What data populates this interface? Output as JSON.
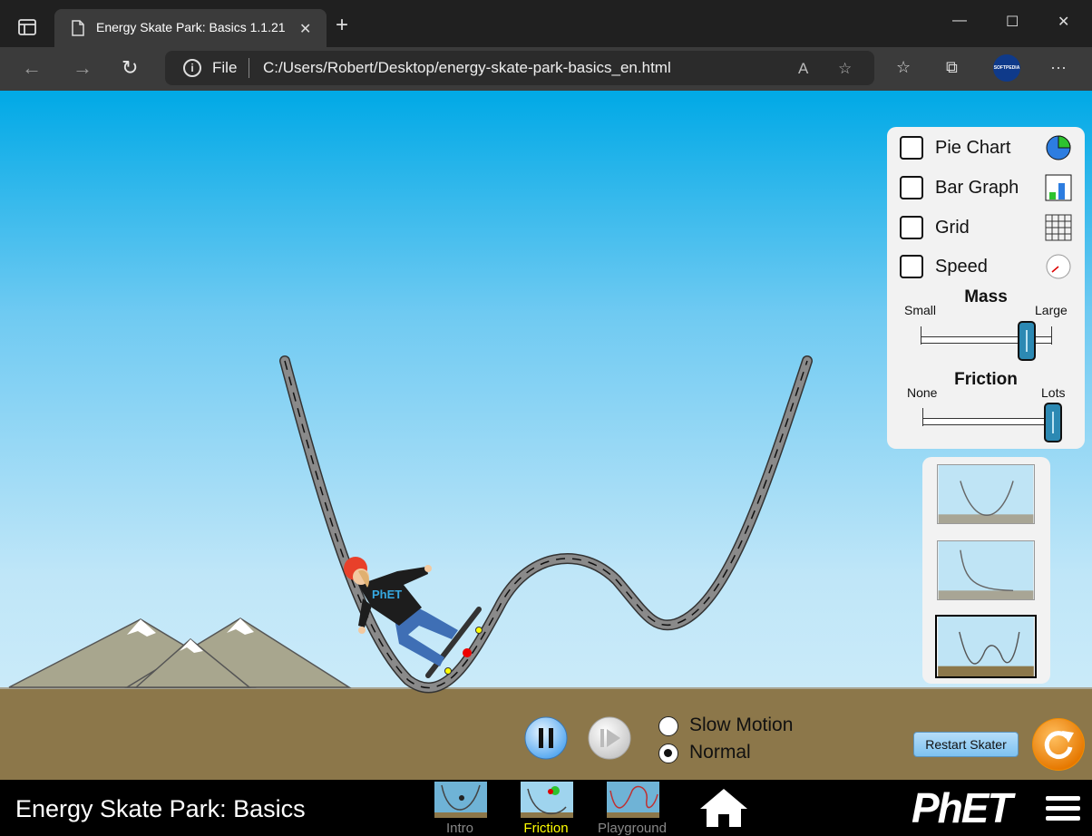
{
  "browser": {
    "tab_title": "Energy Skate Park: Basics 1.1.21",
    "address_scheme": "File",
    "address_url": "C:/Users/Robert/Desktop/energy-skate-park-basics_en.html",
    "profile_label": "SOFTPEDIA"
  },
  "control_panel": {
    "checkboxes": [
      {
        "label": "Pie Chart",
        "checked": false,
        "icon": "pie-chart-icon"
      },
      {
        "label": "Bar Graph",
        "checked": false,
        "icon": "bar-graph-icon"
      },
      {
        "label": "Grid",
        "checked": false,
        "icon": "grid-icon"
      },
      {
        "label": "Speed",
        "checked": false,
        "icon": "speedometer-icon"
      }
    ],
    "mass": {
      "title": "Mass",
      "min_label": "Small",
      "max_label": "Large",
      "value_fraction": 0.87
    },
    "friction": {
      "title": "Friction",
      "min_label": "None",
      "max_label": "Lots",
      "value_fraction": 1.0
    }
  },
  "track_selector": {
    "tracks": [
      "parabola-track",
      "ramp-track",
      "double-well-track"
    ],
    "selected_index": 2
  },
  "playback": {
    "pause_icon": "pause-icon",
    "step_icon": "step-icon",
    "speed_options": [
      "Slow Motion",
      "Normal"
    ],
    "selected_speed": "Normal"
  },
  "buttons": {
    "restart_label": "Restart Skater",
    "reset_icon": "reset-all-icon"
  },
  "navbar": {
    "title": "Energy Skate Park: Basics",
    "screens": [
      {
        "label": "Intro",
        "active": false
      },
      {
        "label": "Friction",
        "active": true
      },
      {
        "label": "Playground",
        "active": false
      }
    ],
    "logo": "PhET"
  },
  "colors": {
    "sky_top": "#00a9e6",
    "ground": "#8c774a",
    "track": "#8a8a8a",
    "slider_thumb": "#2c89b3",
    "reset_button": "#f28c00",
    "active_screen_label": "#ffff00"
  }
}
